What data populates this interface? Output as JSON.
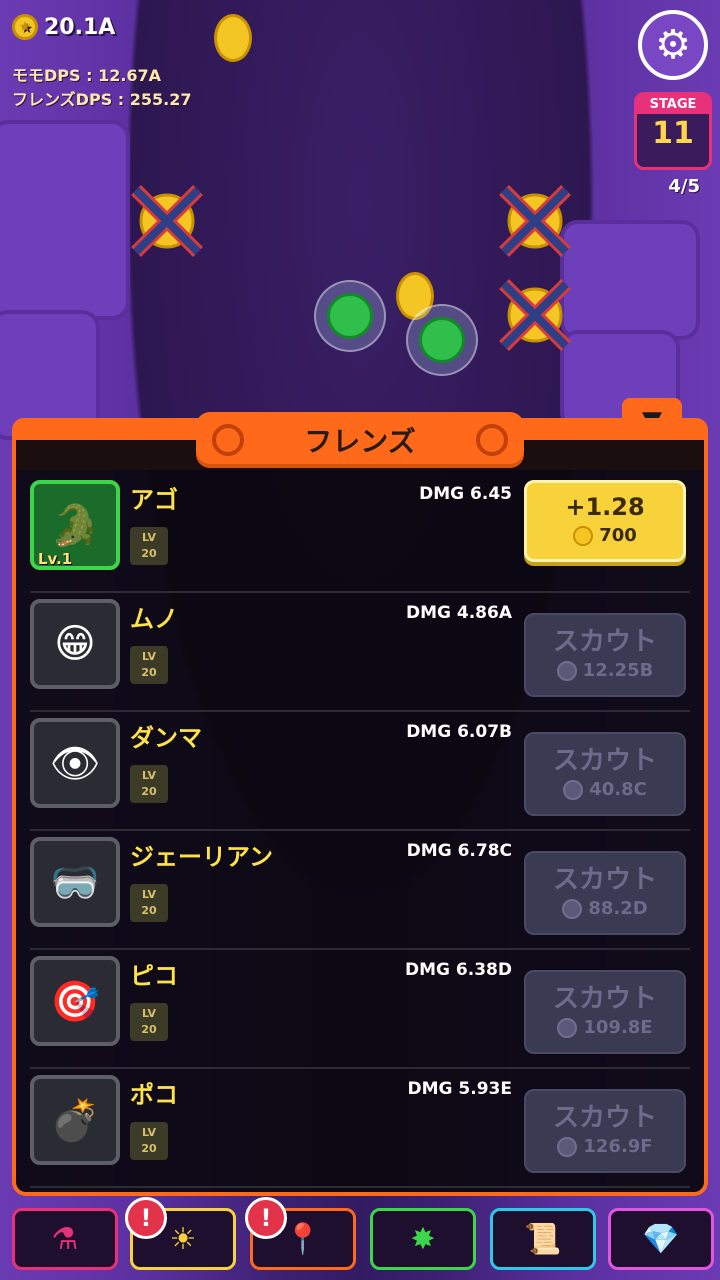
{
  "hud": {
    "coins": "20.1A",
    "momo_dps": "モモDPS : 12.67A",
    "friends_dps": "フレンズDPS : 255.27",
    "stage_label": "STAGE",
    "stage_number": "11",
    "stage_progress": "4/5"
  },
  "panel": {
    "title": "フレンズ",
    "friends": [
      {
        "name": "アゴ",
        "level_tag": "Lv.1",
        "lv_label": "LV",
        "lv_value": "20",
        "dmg": "DMG 6.45",
        "action": "buy",
        "action_main": "+1.28",
        "action_cost": "700",
        "icon": "green-croc-face"
      },
      {
        "name": "ムノ",
        "lv_label": "LV",
        "lv_value": "20",
        "dmg": "DMG 4.86A",
        "action": "scout",
        "action_main": "スカウト",
        "action_cost": "12.25B",
        "icon": "pink-blob-face"
      },
      {
        "name": "ダンマ",
        "lv_label": "LV",
        "lv_value": "20",
        "dmg": "DMG 6.07B",
        "action": "scout",
        "action_main": "スカウト",
        "action_cost": "40.8C",
        "icon": "purple-hood-face"
      },
      {
        "name": "ジェーリアン",
        "lv_label": "LV",
        "lv_value": "20",
        "dmg": "DMG 6.78C",
        "action": "scout",
        "action_main": "スカウト",
        "action_cost": "88.2D",
        "icon": "visor-face"
      },
      {
        "name": "ピコ",
        "lv_label": "LV",
        "lv_value": "20",
        "dmg": "DMG 6.38D",
        "action": "scout",
        "action_main": "スカウト",
        "action_cost": "109.8E",
        "icon": "cyclops-face"
      },
      {
        "name": "ポコ",
        "lv_label": "LV",
        "lv_value": "20",
        "dmg": "DMG 5.93E",
        "action": "scout",
        "action_main": "スカウト",
        "action_cost": "126.9F",
        "icon": "bomb-face"
      }
    ]
  },
  "tabs": [
    {
      "icon": "potion-icon",
      "color": "#e7317a",
      "alert": false
    },
    {
      "icon": "sun-power-icon",
      "color": "#f7d23a",
      "alert": true
    },
    {
      "icon": "bomb-pin-icon",
      "color": "#ff6a1a",
      "alert": true
    },
    {
      "icon": "burst-icon",
      "color": "#3dd64a",
      "alert": false
    },
    {
      "icon": "scroll-icon",
      "color": "#2ec8e8",
      "alert": false
    },
    {
      "icon": "gem-shop-icon",
      "color": "#e056e0",
      "alert": false
    }
  ],
  "alert_glyph": "!"
}
